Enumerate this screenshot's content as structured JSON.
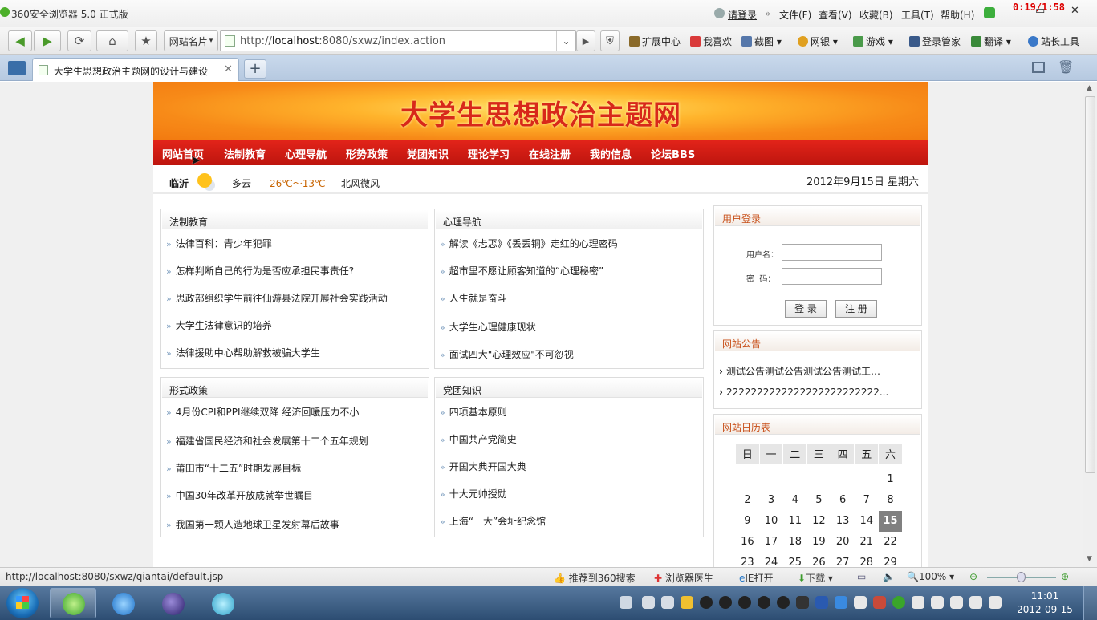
{
  "browser": {
    "title": "360安全浏览器 5.0 正式版",
    "login": "请登录",
    "menus": [
      "文件(F)",
      "查看(V)",
      "收藏(B)",
      "工具(T)",
      "帮助(H)"
    ],
    "timer": "0:19/1:58",
    "url_prefix": "http://",
    "url_host": "localhost",
    "url_rest": ":8080/sxwz/index.action",
    "site_cards": "网站名片",
    "tools": [
      "扩展中心",
      "我喜欢",
      "截图",
      "网银",
      "游戏",
      "登录管家",
      "翻译",
      "站长工具"
    ],
    "tab_title": "大学生思想政治主题网的设计与建设",
    "status_url": "http://localhost:8080/sxwz/qiantai/default.jsp",
    "status_items": [
      "推荐到360搜索",
      "浏览器医生",
      "IE打开",
      "下载"
    ],
    "zoom": "100%"
  },
  "site": {
    "banner_title": "大学生思想政治主题网",
    "nav": [
      "网站首页",
      "法制教育",
      "心理导航",
      "形势政策",
      "党团知识",
      "理论学习",
      "在线注册",
      "我的信息",
      "论坛BBS"
    ],
    "weather": {
      "city": "临沂",
      "desc": "多云",
      "temp": "26℃～13℃",
      "wind": "北风微风"
    },
    "date": "2012年9月15日  星期六"
  },
  "panels": {
    "law": {
      "title": "法制教育",
      "items": [
        "法律百科：青少年犯罪",
        "怎样判断自己的行为是否应承担民事责任?",
        "思政部组织学生前往仙游县法院开展社会实践活动",
        "大学生法律意识的培养",
        "法律援助中心帮助解救被骗大学生"
      ]
    },
    "psych": {
      "title": "心理导航",
      "items": [
        "解读《忐忑》《丢丢铜》走红的心理密码",
        "超市里不愿让顾客知道的“心理秘密”",
        "人生就是奋斗",
        "大学生心理健康现状",
        "面试四大\"心理效应\"不可忽视"
      ]
    },
    "policy": {
      "title": "形式政策",
      "items": [
        "4月份CPI和PPI继续双降 经济回暖压力不小",
        "福建省国民经济和社会发展第十二个五年规划",
        "莆田市“十二五”时期发展目标",
        "中国30年改革开放成就举世瞩目",
        "我国第一颗人造地球卫星发射幕后故事"
      ]
    },
    "party": {
      "title": "党团知识",
      "items": [
        "四项基本原则",
        "中国共产党简史",
        "开国大典开国大典",
        "十大元帅授勋",
        "上海“一大”会址纪念馆"
      ]
    }
  },
  "login": {
    "title": "用户登录",
    "user_label": "用户名：",
    "pass_label": "密  码：",
    "login_btn": "登 录",
    "register_btn": "注 册"
  },
  "notice": {
    "title": "网站公告",
    "items": [
      "测试公告测试公告测试公告测试工…",
      "2222222222222222222222222..."
    ]
  },
  "calendar": {
    "title": "网站日历表",
    "headers": [
      "日",
      "一",
      "二",
      "三",
      "四",
      "五",
      "六"
    ],
    "rows": [
      [
        "",
        "",
        "",
        "",
        "",
        "",
        "1"
      ],
      [
        "2",
        "3",
        "4",
        "5",
        "6",
        "7",
        "8"
      ],
      [
        "9",
        "10",
        "11",
        "12",
        "13",
        "14",
        "15"
      ],
      [
        "16",
        "17",
        "18",
        "19",
        "20",
        "21",
        "22"
      ],
      [
        "23",
        "24",
        "25",
        "26",
        "27",
        "28",
        "29"
      ]
    ],
    "today": "15"
  },
  "taskbar": {
    "time": "11:01",
    "date": "2012-09-15"
  },
  "colors": {
    "brand_red": "#d8281a",
    "menu_red": "#e3241a",
    "accent_orange": "#f78a18"
  }
}
